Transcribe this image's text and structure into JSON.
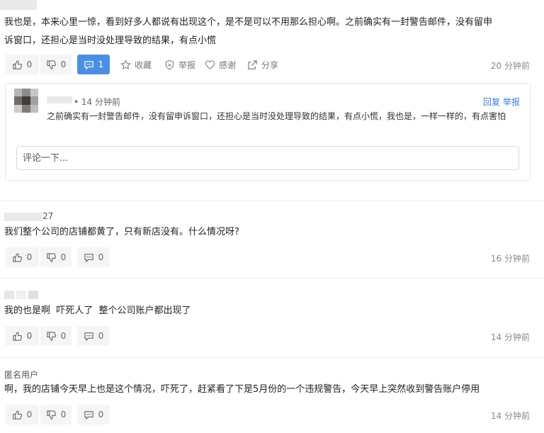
{
  "top_comment": {
    "text_line1": "我也是，本来心里一惊，看到好多人都说有出现这个，是不是可以不用那么担心啊。之前确实有一封警告邮件，没有留申",
    "text_line2": "诉窗口，还担心是当时没处理导致的结果，有点小慌",
    "likes": "0",
    "dislikes": "0",
    "replies": "1",
    "collect_label": "收藏",
    "report_label": "举报",
    "thanks_label": "感谢",
    "share_label": "分享",
    "time": "20 分钟前"
  },
  "reply": {
    "meta": "• 14 分钟前",
    "reply_label": "回复",
    "report_label": "举报",
    "text": "之前确实有一封警告邮件，没有留申诉窗口，还担心是当时没处理导致的结果，有点小慌，我也是，一样一样的，有点害怕",
    "input_placeholder": "评论一下..."
  },
  "comments": [
    {
      "user_suffix": "27",
      "text": "我们整个公司的店铺都黄了，只有新店没有。什么情况呀?",
      "likes": "0",
      "dislikes": "0",
      "replies": "0",
      "time": "16 分钟前"
    },
    {
      "user_suffix": "",
      "text": "我的也是啊  吓死人了  整个公司账户都出现了",
      "likes": "0",
      "dislikes": "0",
      "replies": "0",
      "time": "14 分钟前"
    },
    {
      "user_name": "匿名用户",
      "text": "啊，我的店铺今天早上也是这个情况，吓死了，赶紧看了下是5月份的一个违规警告，今天早上突然收到警告账户停用",
      "likes": "0",
      "dislikes": "0",
      "replies": "0",
      "time": "14 分钟前"
    }
  ],
  "colors": {
    "accent": "#4a90e2",
    "link": "#3b7bd9",
    "button_bg": "#f4f5f7"
  },
  "icons": [
    "thumbs-up-icon",
    "thumbs-down-icon",
    "comment-icon",
    "star-icon",
    "shield-icon",
    "heart-icon",
    "share-icon"
  ]
}
